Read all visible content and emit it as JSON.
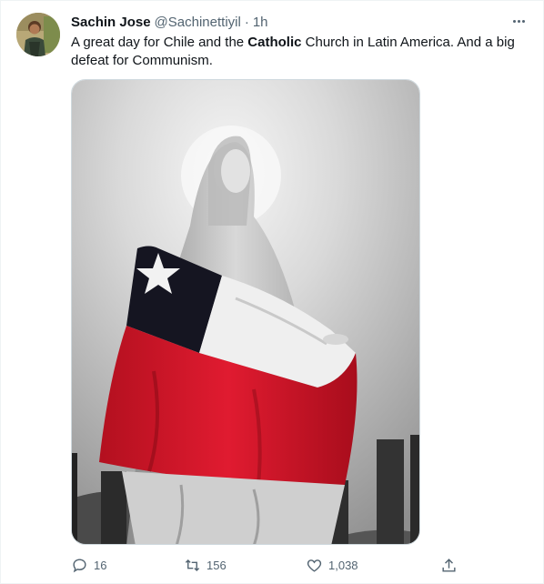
{
  "tweet": {
    "author_name": "Sachin Jose",
    "author_handle": "@Sachinettiyil",
    "separator": "·",
    "time": "1h",
    "text_before": "A great day for Chile and the ",
    "text_bold": "Catholic",
    "text_after": " Church in Latin America. And a big defeat for Communism."
  },
  "image": {
    "description_icon": "statue-with-flag-image",
    "flag_colors": {
      "red": "#d6162b",
      "white": "#f1f1f1",
      "blue": "#1a1a2e"
    }
  },
  "actions": {
    "reply_count": "16",
    "retweet_count": "156",
    "like_count": "1,038"
  },
  "icons": {
    "more": "more-icon",
    "reply": "reply-icon",
    "retweet": "retweet-icon",
    "like": "like-icon",
    "share": "share-icon"
  },
  "colors": {
    "text": "#0f1419",
    "muted": "#536471",
    "border": "#cfd9de"
  }
}
